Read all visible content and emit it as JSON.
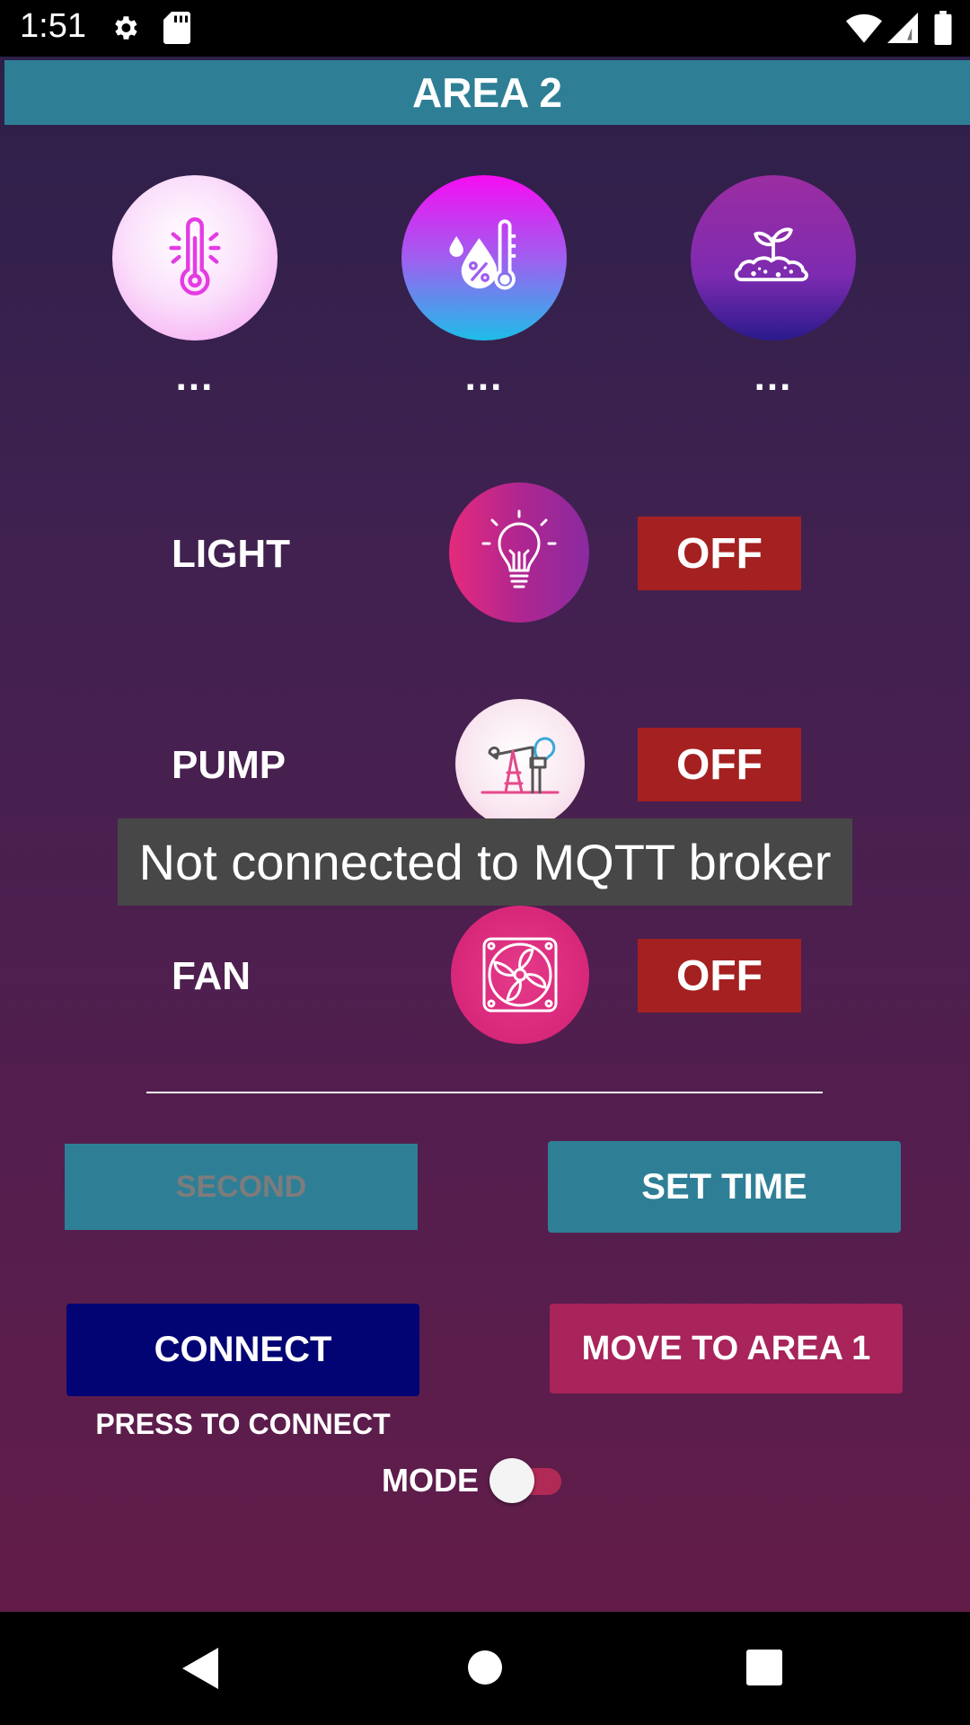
{
  "status_bar": {
    "time": "1:51"
  },
  "header": {
    "title": "AREA 2"
  },
  "sensors": [
    {
      "icon": "thermometer-icon",
      "value": "..."
    },
    {
      "icon": "humidity-icon",
      "value": "..."
    },
    {
      "icon": "soil-icon",
      "value": "..."
    }
  ],
  "devices": [
    {
      "label": "LIGHT",
      "icon": "lightbulb-icon",
      "state": "OFF"
    },
    {
      "label": "PUMP",
      "icon": "pumpjack-icon",
      "state": "OFF"
    },
    {
      "label": "FAN",
      "icon": "fan-icon",
      "state": "OFF"
    }
  ],
  "toast": "Not connected to MQTT broker",
  "buttons": {
    "second": "SECOND",
    "set_time": "SET TIME",
    "connect": "CONNECT",
    "move": "MOVE TO AREA 1"
  },
  "connect_hint": "PRESS TO CONNECT",
  "mode": {
    "label": "MODE",
    "on": false
  },
  "colors": {
    "header": "#2e7f96",
    "off_button": "#a52020",
    "connect_button": "#020474",
    "move_button": "#a8245a"
  }
}
